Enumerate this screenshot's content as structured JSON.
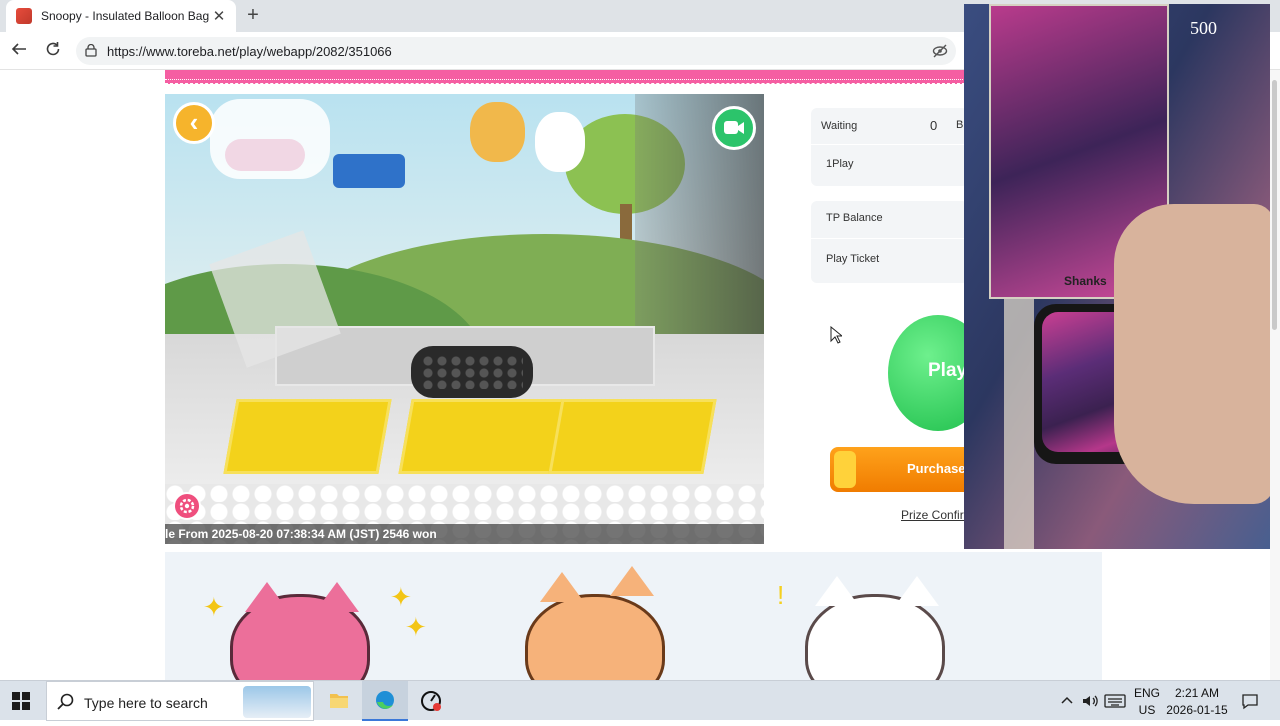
{
  "browser": {
    "tab_title": "Snoopy - Insulated Balloon Bag S",
    "tab_close": "✕",
    "new_tab": "+",
    "url": "https://www.toreba.net/play/webapp/2082/351066"
  },
  "video": {
    "caption": "le From 2025-08-20 07:38:34 AM (JST) 2546 won"
  },
  "panel": {
    "waiting_label": "Waiting",
    "waiting_value": "0",
    "waiting_extra": "B",
    "one_play_label": "1Play",
    "tp_balance_label": "TP Balance",
    "play_ticket_label": "Play Ticket",
    "play_button": "Play",
    "purchase_button": "Purchase",
    "prize_link": "Prize Confirm"
  },
  "overlay": {
    "card_number": "500",
    "card_name": "Shanks"
  },
  "taskbar": {
    "search_placeholder": "Type here to search",
    "language": "ENG",
    "region": "US",
    "time": "2:21 AM",
    "date": "2026-01-15"
  },
  "colors": {
    "accent_pink": "#f55ea2",
    "play_green": "#1fbf4c",
    "purchase_orange": "#f07c00"
  }
}
